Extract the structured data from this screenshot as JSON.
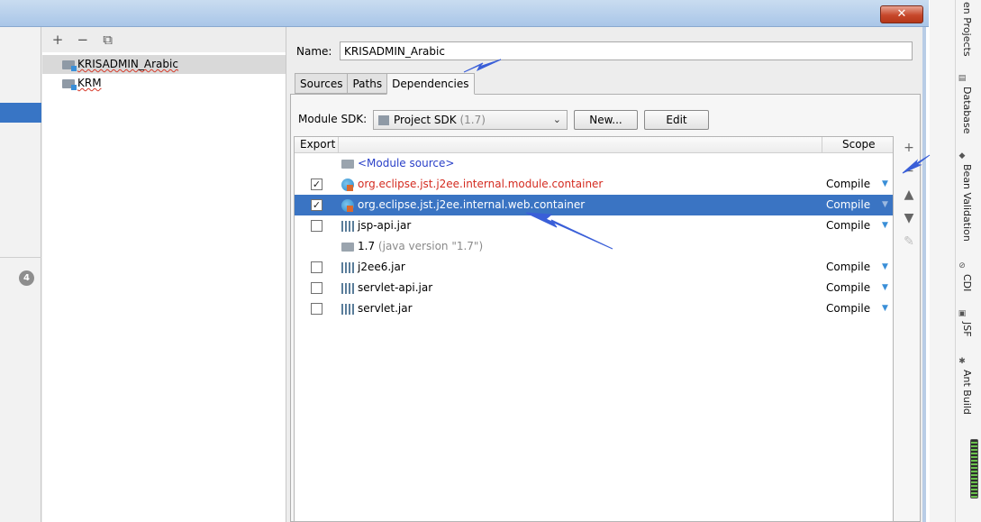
{
  "dialog": {
    "close_label": "✕"
  },
  "left_strip": {
    "badge": "4"
  },
  "tree": {
    "toolbar": {
      "add": "+",
      "remove": "−",
      "copy": "⧉"
    },
    "items": [
      {
        "label": "KRISADMIN_Arabic",
        "selected": true
      },
      {
        "label": "KRM",
        "selected": false
      }
    ]
  },
  "module": {
    "name_label": "Name:",
    "name_value": "KRISADMIN_Arabic",
    "tabs": [
      "Sources",
      "Paths",
      "Dependencies"
    ],
    "active_tab": "Dependencies",
    "sdk_label": "Module SDK:",
    "sdk_value": "Project SDK",
    "sdk_version": "(1.7)",
    "new_button": "New...",
    "edit_button": "Edit"
  },
  "dependencies": {
    "columns": {
      "export": "Export",
      "scope": "Scope"
    },
    "rows": [
      {
        "checkbox": null,
        "icon": "folder-icon",
        "text": "<Module source>",
        "scope": "",
        "color": "#2a40c8"
      },
      {
        "checkbox": true,
        "icon": "library-icon",
        "text": "org.eclipse.jst.j2ee.internal.module.container",
        "scope": "Compile",
        "color": "#d42b20"
      },
      {
        "checkbox": true,
        "icon": "library-icon",
        "text": "org.eclipse.jst.j2ee.internal.web.container",
        "scope": "Compile",
        "selected": true
      },
      {
        "checkbox": false,
        "icon": "jar-icon",
        "text": "jsp-api.jar",
        "scope": "Compile"
      },
      {
        "checkbox": null,
        "icon": "folder-icon",
        "text": "1.7",
        "subtext": "(java version \"1.7\")",
        "scope": ""
      },
      {
        "checkbox": false,
        "icon": "jar-icon",
        "text": "j2ee6.jar",
        "scope": "Compile"
      },
      {
        "checkbox": false,
        "icon": "jar-icon",
        "text": "servlet-api.jar",
        "scope": "Compile"
      },
      {
        "checkbox": false,
        "icon": "jar-icon",
        "text": "servlet.jar",
        "scope": "Compile"
      }
    ],
    "side_tools": {
      "add": "+",
      "remove": "−",
      "up": "▲",
      "down": "▼",
      "edit": "✎"
    },
    "scope_arrow": "▼",
    "check_mark": "✓"
  },
  "ide_tool_windows": [
    {
      "label": "en Projects"
    },
    {
      "label": "Database"
    },
    {
      "label": "Bean Validation"
    },
    {
      "label": "CDI"
    },
    {
      "label": "JSF"
    },
    {
      "label": "Ant Build"
    }
  ],
  "colors": {
    "selection": "#3a74c3",
    "accent_arrow": "#3a5fd8"
  }
}
